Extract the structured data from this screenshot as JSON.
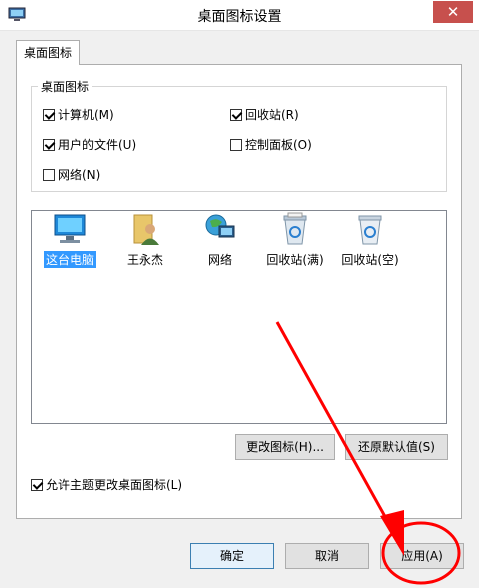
{
  "window": {
    "title": "桌面图标设置",
    "close_glyph": "✕"
  },
  "tab": {
    "label": "桌面图标"
  },
  "group": {
    "title": "桌面图标"
  },
  "checkboxes": [
    {
      "label": "计算机(M)",
      "checked": true
    },
    {
      "label": "回收站(R)",
      "checked": true
    },
    {
      "label": "用户的文件(U)",
      "checked": true
    },
    {
      "label": "控制面板(O)",
      "checked": false
    },
    {
      "label": "网络(N)",
      "checked": false
    }
  ],
  "icons": [
    {
      "label": "这台电脑",
      "icon": "computer-icon",
      "selected": true
    },
    {
      "label": "王永杰",
      "icon": "user-folder-icon",
      "selected": false
    },
    {
      "label": "网络",
      "icon": "network-icon",
      "selected": false
    },
    {
      "label": "回收站(满)",
      "icon": "recycle-bin-full-icon",
      "selected": false
    },
    {
      "label": "回收站(空)",
      "icon": "recycle-bin-empty-icon",
      "selected": false
    }
  ],
  "buttons": {
    "change_icon": "更改图标(H)...",
    "restore_default": "还原默认值(S)",
    "ok": "确定",
    "cancel": "取消",
    "apply": "应用(A)"
  },
  "allow_themes": {
    "label": "允许主题更改桌面图标(L)",
    "checked": true
  },
  "colors": {
    "selection": "#3399ff",
    "annotation": "#ff0000",
    "close": "#c7504d"
  }
}
